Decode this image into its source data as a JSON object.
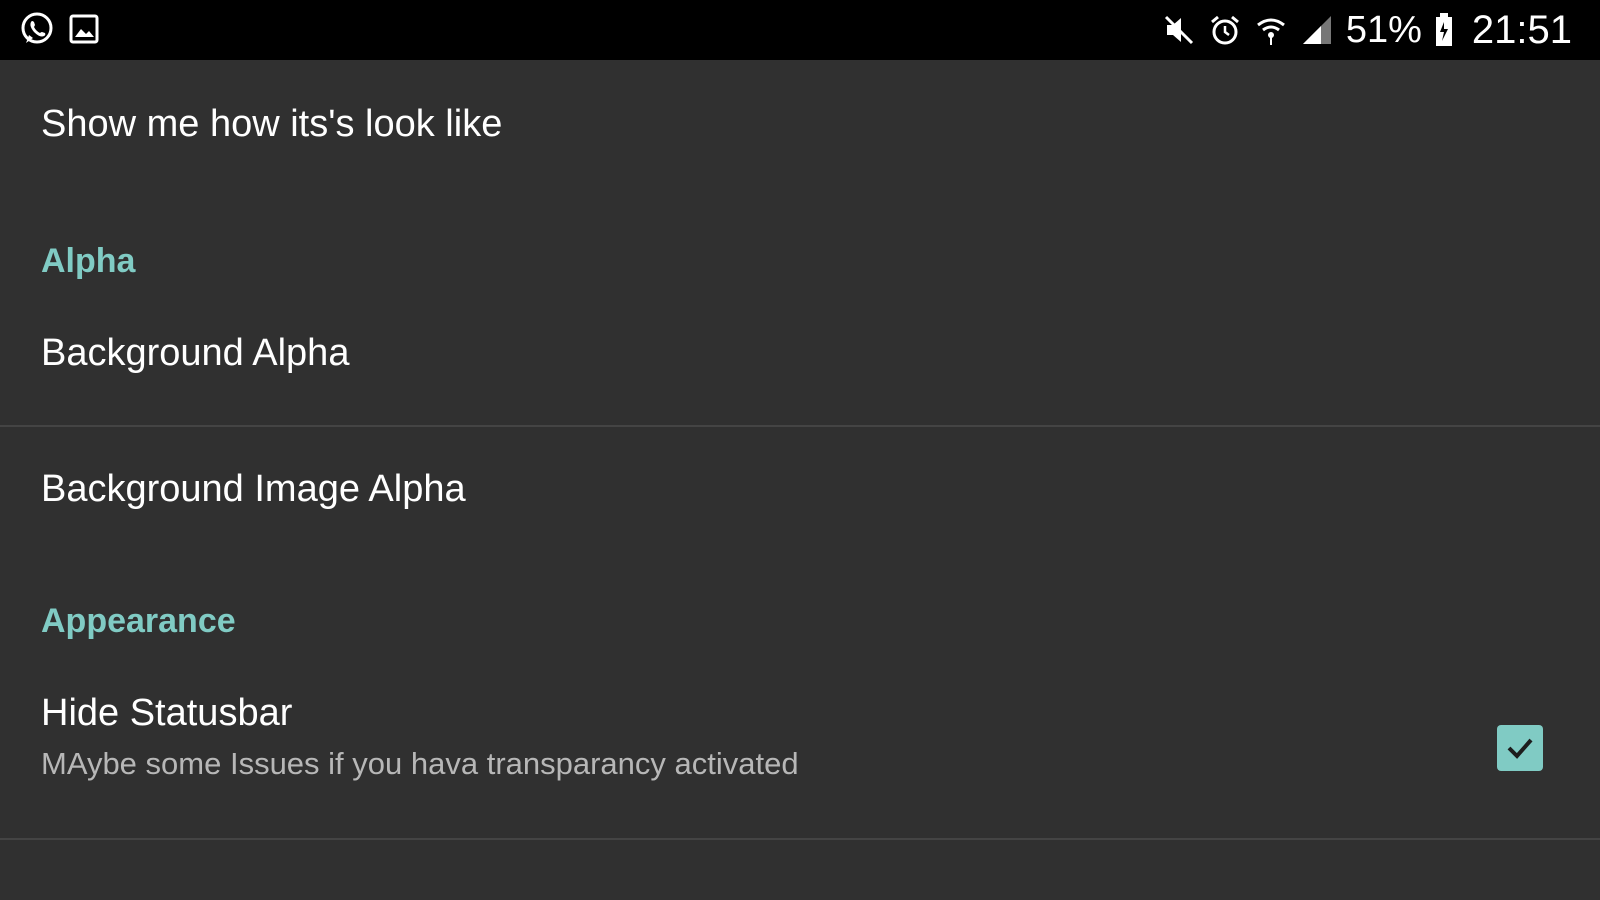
{
  "status_bar": {
    "battery_text": "51%",
    "time": "21:51",
    "icons_left": [
      "whatsapp-icon",
      "image-icon"
    ],
    "icons_right": [
      "mute-icon",
      "alarm-icon",
      "wifi-icon",
      "signal-icon",
      "battery-icon"
    ]
  },
  "preferences": {
    "preview_title": "Show me how its's look like",
    "alpha_category": "Alpha",
    "background_alpha": "Background Alpha",
    "background_image_alpha": "Background Image Alpha",
    "appearance_category": "Appearance",
    "hide_statusbar_title": "Hide Statusbar",
    "hide_statusbar_summary": "MAybe some Issues if you hava transparancy activated",
    "hide_statusbar_checked": true
  },
  "colors": {
    "accent": "#80cbc4",
    "background": "#303030",
    "statusbar": "#000000"
  }
}
